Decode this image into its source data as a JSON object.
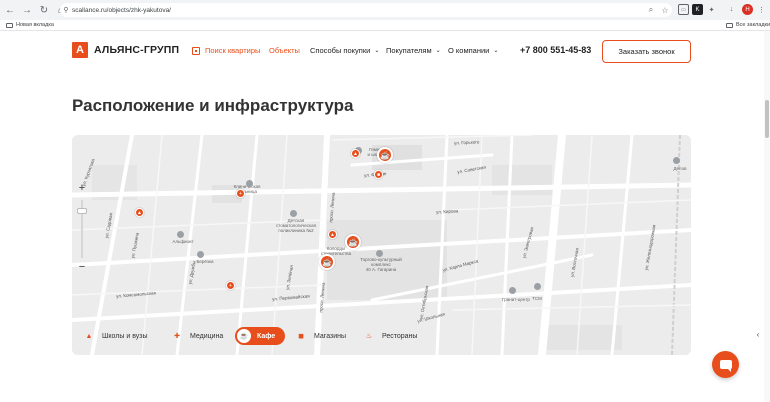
{
  "browser": {
    "url": "scallance.ru/objects/zhk-yakutova/",
    "bookmark_left": "Новая вкладка",
    "bookmark_right": "Все закладки",
    "profile_initial": "Н"
  },
  "header": {
    "logo_letter": "А",
    "logo_text": "АЛЬЯНС-ГРУПП",
    "nav": [
      {
        "label": "Поиск квартиры"
      },
      {
        "label": "Объекты"
      },
      {
        "label": "Способы покупки"
      },
      {
        "label": "Покупателям"
      },
      {
        "label": "О компании"
      }
    ],
    "phone": "+7 800 551-45-83",
    "callback_label": "Заказать звонок"
  },
  "section": {
    "title": "Расположение и инфраструктура"
  },
  "map": {
    "zoom_in": "+",
    "zoom_out": "−",
    "labels": {
      "school": "Гимназия\nи школа №",
      "clinic": "Клиническая\nбольница",
      "dental": "Детская\nстоматологическая\nполиклиника №2",
      "church": "Альфиоит",
      "kolodtsy": "Колодцы\nстроительства",
      "mall": "Торгово-культурный\nкомплекс\n40 А. Гагарина",
      "berezka": "Берёзка",
      "granit": "Гранит-центр",
      "tsm": "ТСМ",
      "delovoy": "Делов"
    },
    "streets": {
      "kurchatov": "ул. Курчатова",
      "sadovaya": "ул. Садовая",
      "pushkin": "ул. Пушкина",
      "komsomolskaya": "ул. Комсомольская",
      "lenin": "просп. Ленина",
      "frunze": "ул. Фрунзе",
      "lenina2": "просп. Ленина",
      "karl": "ул. Карла Маркса",
      "gorkogo": "ул. Горького",
      "kirova": "ул. Кирова",
      "elektro": "ул. Электровая",
      "oktyabr": "ул. Октябрьская",
      "druzhby": "ул. Дружбы",
      "zelenaya": "ул. Зелёная",
      "shkolnaya": "ул. Школьная",
      "pervomay": "ул. Первомайская",
      "vostochnaya": "ул. Восточная",
      "sovetskaya": "ул. Советская",
      "zheleznodorozh": "ул. Железнодорожная"
    },
    "categories": [
      {
        "label": "Школы и вузы",
        "icon": "graduation-cap-icon"
      },
      {
        "label": "Медицина",
        "icon": "hospital-icon"
      },
      {
        "label": "Кафе",
        "icon": "coffee-cup-icon"
      },
      {
        "label": "Магазины",
        "icon": "shopping-bag-icon"
      },
      {
        "label": "Рестораны",
        "icon": "restaurant-icon"
      }
    ],
    "active_category": "Кафе"
  },
  "colors": {
    "accent": "#e84e1b",
    "map_bg": "#ececec",
    "text": "#222222"
  }
}
